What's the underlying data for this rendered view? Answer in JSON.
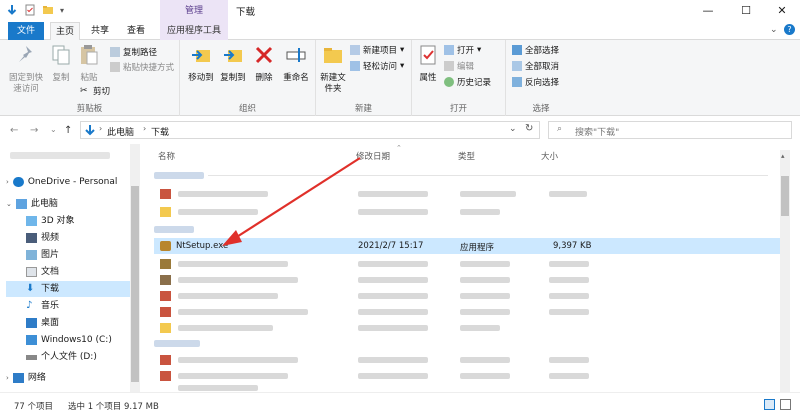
{
  "window": {
    "title": "下载",
    "context_tab": "管理",
    "controls": {
      "minimize": "—",
      "maximize": "☐",
      "close": "✕"
    }
  },
  "ribbon_tabs": {
    "file": "文件",
    "home": "主页",
    "share": "共享",
    "view": "查看",
    "app_tools": "应用程序工具"
  },
  "ribbon": {
    "clipboard": {
      "label": "剪贴板",
      "pin": "固定到快速访问",
      "copy": "复制",
      "paste": "粘贴",
      "copy_path": "复制路径",
      "paste_shortcut": "粘贴快捷方式",
      "cut": "剪切"
    },
    "organize": {
      "label": "组织",
      "move_to": "移动到",
      "copy_to": "复制到",
      "delete": "删除",
      "rename": "重命名"
    },
    "new": {
      "label": "新建",
      "new_folder": "新建文件夹",
      "new_item": "新建项目",
      "easy_access": "轻松访问"
    },
    "open": {
      "label": "打开",
      "properties": "属性",
      "open": "打开",
      "edit": "编辑",
      "history": "历史记录"
    },
    "select": {
      "label": "选择",
      "select_all": "全部选择",
      "select_none": "全部取消",
      "invert": "反向选择"
    }
  },
  "nav": {
    "path_pc": "此电脑",
    "path_folder": "下载",
    "search_placeholder": "搜索\"下载\""
  },
  "sidebar": {
    "items": [
      {
        "label": "OneDrive - Personal"
      },
      {
        "label": "此电脑"
      },
      {
        "label": "3D 对象"
      },
      {
        "label": "视频"
      },
      {
        "label": "图片"
      },
      {
        "label": "文档"
      },
      {
        "label": "下载"
      },
      {
        "label": "音乐"
      },
      {
        "label": "桌面"
      },
      {
        "label": "Windows10 (C:)"
      },
      {
        "label": "个人文件 (D:)"
      },
      {
        "label": "网络"
      }
    ]
  },
  "columns": {
    "name": "名称",
    "date": "修改日期",
    "type": "类型",
    "size": "大小"
  },
  "file": {
    "name": "NtSetup.exe",
    "date": "2021/2/7 15:17",
    "type": "应用程序",
    "size": "9,397 KB"
  },
  "status": {
    "count": "77 个项目",
    "selected": "选中 1 个项目 9.17 MB"
  },
  "colors": {
    "accent": "#1979ca",
    "selection": "#cce8ff",
    "arrow": "#e0302a"
  }
}
